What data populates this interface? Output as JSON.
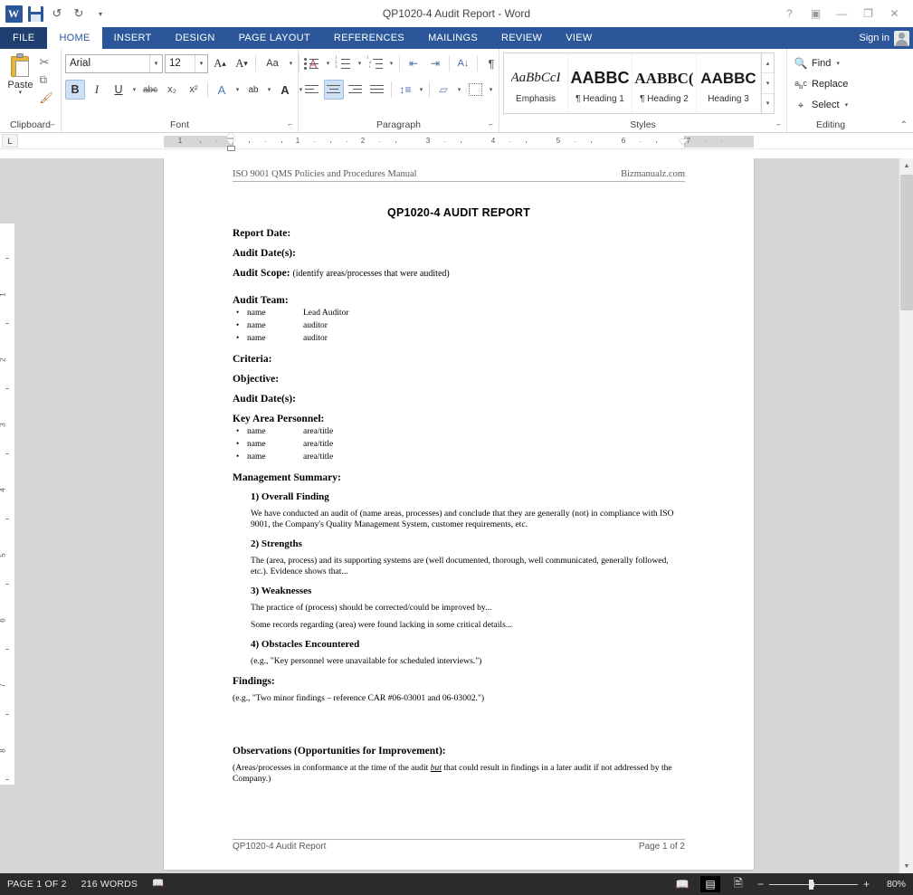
{
  "titlebar": {
    "app_icon": "word-logo-icon",
    "save_label": "save-icon",
    "undo_label": "↺",
    "redo_label": "↻",
    "qat_more": "▾",
    "title": "QP1020-4 Audit Report - Word",
    "help": "?",
    "ribbon_display": "▣",
    "minimize": "—",
    "restore": "❐",
    "close": "✕"
  },
  "tabs": {
    "file": "FILE",
    "items": [
      "HOME",
      "INSERT",
      "DESIGN",
      "PAGE LAYOUT",
      "REFERENCES",
      "MAILINGS",
      "REVIEW",
      "VIEW"
    ],
    "active": "HOME",
    "signin": "Sign in"
  },
  "ribbon": {
    "clipboard": {
      "label": "Clipboard",
      "paste": "Paste",
      "paste_arrow": "▾",
      "cut": "✂",
      "copy": "⧉",
      "format_painter": "🖌"
    },
    "font": {
      "label": "Font",
      "font_name": "Arial",
      "font_size": "12",
      "grow_font": "A",
      "shrink_font": "A",
      "change_case": "Aa",
      "clear_formatting": "A",
      "bold": "B",
      "italic": "I",
      "underline": "U",
      "strikethrough": "abc",
      "subscript": "x₂",
      "superscript": "x²",
      "text_effects": "A",
      "highlight": "ab",
      "font_color": "A",
      "dropdown_arrow": "▾"
    },
    "paragraph": {
      "label": "Paragraph",
      "bullets": "bullet-list-icon",
      "numbering": "numbered-list-icon",
      "multilevel": "multilevel-list-icon",
      "decrease_indent": "decrease-indent-icon",
      "increase_indent": "increase-indent-icon",
      "sort": "sort-icon",
      "show_marks": "¶",
      "align_left": "align-left-icon",
      "align_center": "align-center-icon",
      "align_right": "align-right-icon",
      "justify": "justify-icon",
      "line_spacing": "line-spacing-icon",
      "shading": "shading-icon",
      "borders": "borders-icon"
    },
    "styles": {
      "label": "Styles",
      "items": [
        {
          "preview": "AaBbCcI",
          "name": "Emphasis"
        },
        {
          "preview": "AABBC",
          "name": "¶ Heading 1"
        },
        {
          "preview": "AABBC(",
          "name": "¶ Heading 2"
        },
        {
          "preview": "AABBC",
          "name": "Heading 3"
        }
      ],
      "scroll_up": "▴",
      "scroll_down": "▾",
      "more": "▾"
    },
    "editing": {
      "label": "Editing",
      "find": "Find",
      "replace": "Replace",
      "select": "Select",
      "arrow": "▾"
    },
    "collapse": "⌃",
    "dialog_launcher": "⌐"
  },
  "ruler": {
    "tab_stop": "L",
    "h_numbers": [
      "1",
      "1",
      "2",
      "3",
      "4",
      "5",
      "6",
      "7"
    ],
    "v_numbers": [
      "1",
      "2",
      "3",
      "4",
      "5",
      "6",
      "7",
      "8"
    ]
  },
  "document": {
    "header_left": "ISO 9001 QMS Policies and Procedures Manual",
    "header_right": "Bizmanualz.com",
    "title": "QP1020-4 AUDIT REPORT",
    "fields": [
      {
        "label": "Report Date:",
        "value": ""
      },
      {
        "label": "Audit Date(s):",
        "value": ""
      },
      {
        "label": "Audit Scope:",
        "value": "(identify areas/processes that were audited)"
      }
    ],
    "audit_team_label": "Audit Team:",
    "audit_team": [
      {
        "name": "name",
        "role": "Lead Auditor"
      },
      {
        "name": "name",
        "role": "auditor"
      },
      {
        "name": "name",
        "role": "auditor"
      }
    ],
    "criteria_label": "Criteria:",
    "objective_label": "Objective:",
    "audit_dates_label": "Audit Date(s):",
    "key_area_label": "Key Area Personnel:",
    "key_area_personnel": [
      {
        "name": "name",
        "role": "area/title"
      },
      {
        "name": "name",
        "role": "area/title"
      },
      {
        "name": "name",
        "role": "area/title"
      }
    ],
    "management_summary_label": "Management Summary:",
    "sections": [
      {
        "heading": "1) Overall Finding",
        "paragraphs": [
          "We have conducted an audit of (name areas, processes) and conclude that they are generally (not) in compliance with ISO 9001, the Company's Quality Management System, customer requirements, etc."
        ]
      },
      {
        "heading": "2) Strengths",
        "paragraphs": [
          "The (area, process) and its supporting systems are (well documented, thorough, well communicated, generally followed, etc.).  Evidence shows that..."
        ]
      },
      {
        "heading": "3) Weaknesses",
        "paragraphs": [
          "The practice of (process) should be corrected/could be improved by...",
          "Some records regarding (area) were found lacking in some critical details..."
        ]
      },
      {
        "heading": "4) Obstacles Encountered",
        "paragraphs": [
          "(e.g., \"Key personnel were unavailable for scheduled interviews.\")"
        ]
      }
    ],
    "findings_label": "Findings:",
    "findings_text": "(e.g., \"Two minor findings – reference CAR #06-03001 and 06-03002.\")",
    "observations_label": "Observations (Opportunities for Improvement):",
    "observations_pre": "(Areas/processes in conformance at the time of the audit ",
    "observations_emph": "but",
    "observations_post": " that could result in findings in a later audit if not addressed by the Company.)",
    "footer_left": "QP1020-4 Audit Report",
    "footer_right": "Page 1 of 2"
  },
  "statusbar": {
    "page": "PAGE 1 OF 2",
    "words": "216 WORDS",
    "proofing": "proofing-icon",
    "read_mode": "read-mode-icon",
    "print_layout": "print-layout-icon",
    "web_layout": "web-layout-icon",
    "zoom_out": "−",
    "zoom_in": "+",
    "zoom_level": "80%"
  }
}
